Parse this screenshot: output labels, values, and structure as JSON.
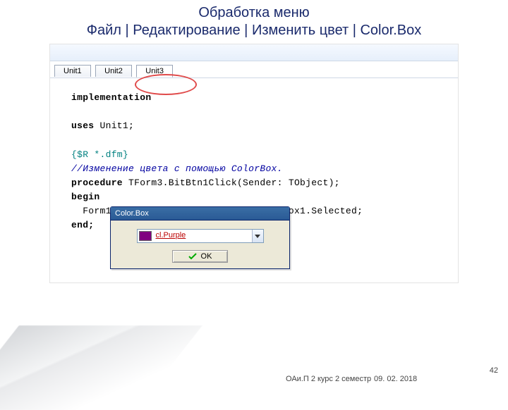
{
  "title": {
    "line1": "Обработка меню",
    "line2": "Файл | Редактирование | Изменить цвет | Color.Box"
  },
  "tabs": {
    "t1": "Unit1",
    "t2": "Unit2",
    "t3": "Unit3"
  },
  "code": {
    "impl": "implementation",
    "uses": "uses",
    "uses_unit": " Unit1;",
    "directive": "{$R *.dfm}",
    "comment": "//Изменение цвета с помощью ColorBox.",
    "proc_kw": "procedure",
    "proc_sig": " TForm3.BitBtn1Click(Sender: TObject);",
    "begin": "begin",
    "body": "  Form1.Memo1.Font.Color:=Form3.ColorBox1.Selected;",
    "end": "end;"
  },
  "dialog": {
    "title": "Color.Box",
    "value": "cl.Purple",
    "ok": "OK"
  },
  "footer": {
    "course": "ОАи.П 2 курс 2 семестр",
    "date": "09. 02. 2018"
  },
  "page": "42"
}
